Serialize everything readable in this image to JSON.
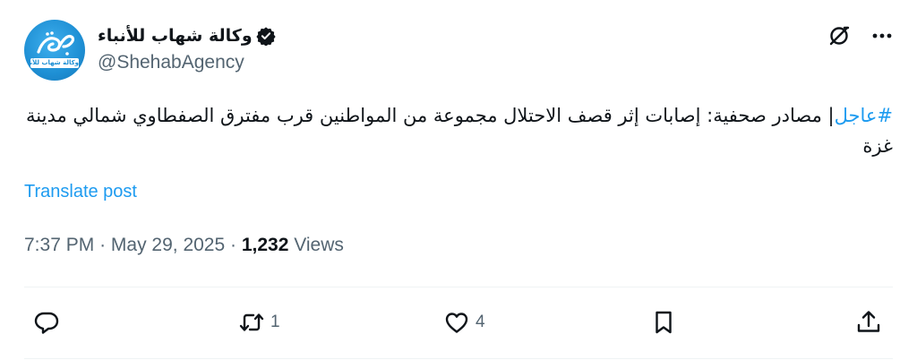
{
  "account": {
    "display_name": "وكالة شهاب للأنباء",
    "handle": "@ShehabAgency",
    "avatar_script_text": "شهاب",
    "avatar_band_text": "وكالة شهاب للأنباء"
  },
  "tweet": {
    "hashtag": "#عاجل",
    "body": "| مصادر صحفية: إصابات إثر قصف الاحتلال مجموعة من المواطنين قرب مفترق الصفطاوي شمالي مدينة غزة",
    "translate_label": "Translate post"
  },
  "meta": {
    "time": "7:37 PM",
    "separator": "·",
    "date": "May 29, 2025",
    "views_count": "1,232",
    "views_label": "Views"
  },
  "actions": {
    "reply_count": "",
    "retweet_count": "1",
    "like_count": "4"
  },
  "icons": {
    "verified": "verified-badge-icon",
    "grok": "grok-icon",
    "more": "more-icon",
    "reply": "reply-icon",
    "retweet": "retweet-icon",
    "like": "heart-icon",
    "bookmark": "bookmark-icon",
    "share": "share-icon"
  },
  "colors": {
    "accent": "#1d9bf0",
    "text_primary": "#0f1419",
    "text_secondary": "#536471",
    "divider": "#eff3f4",
    "avatar_bg": "#1e8fd4"
  }
}
